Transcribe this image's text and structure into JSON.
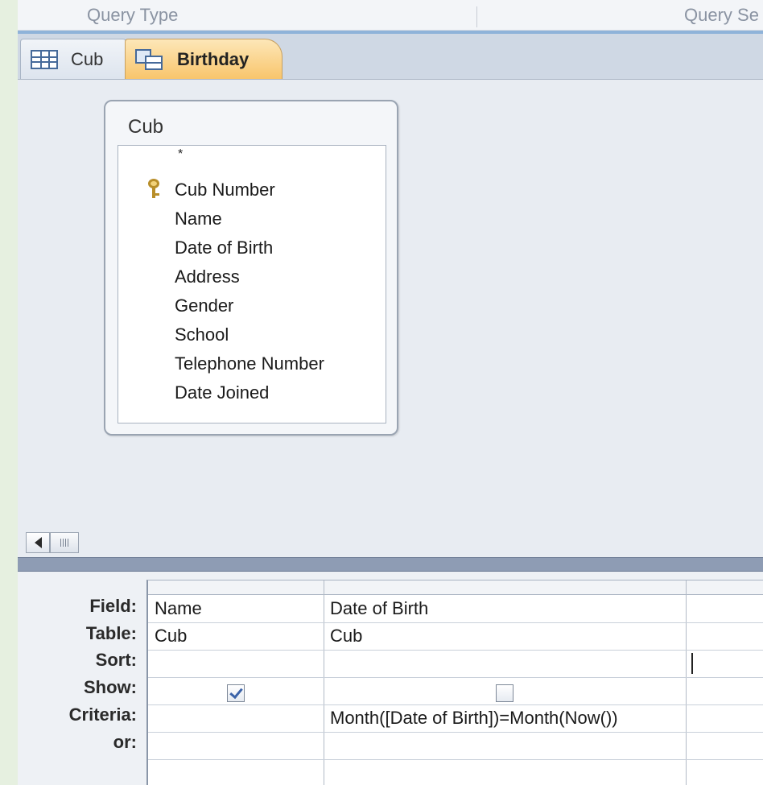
{
  "ribbon": {
    "group_left": "Query Type",
    "group_right": "Query Se"
  },
  "tabs": [
    {
      "label": "Cub",
      "icon": "table-icon",
      "active": false
    },
    {
      "label": "Birthday",
      "icon": "query-icon",
      "active": true
    }
  ],
  "field_list": {
    "title": "Cub",
    "fields": [
      {
        "name": "*",
        "primary_key": false
      },
      {
        "name": "Cub Number",
        "primary_key": true
      },
      {
        "name": "Name",
        "primary_key": false
      },
      {
        "name": "Date of Birth",
        "primary_key": false
      },
      {
        "name": "Address",
        "primary_key": false
      },
      {
        "name": "Gender",
        "primary_key": false
      },
      {
        "name": "School",
        "primary_key": false
      },
      {
        "name": "Telephone Number",
        "primary_key": false
      },
      {
        "name": "Date Joined",
        "primary_key": false
      }
    ]
  },
  "grid": {
    "row_labels": [
      "Field:",
      "Table:",
      "Sort:",
      "Show:",
      "Criteria:",
      "or:"
    ],
    "columns": [
      {
        "field": "Name",
        "table": "Cub",
        "sort": "",
        "show": true,
        "criteria": "",
        "or": ""
      },
      {
        "field": "Date of Birth",
        "table": "Cub",
        "sort": "",
        "show": false,
        "criteria": "Month([Date of Birth])=Month(Now())",
        "or": ""
      },
      {
        "field": "",
        "table": "",
        "sort": "",
        "show": false,
        "criteria": "",
        "or": ""
      }
    ]
  },
  "colors": {
    "active_tab": "#f8c56c",
    "splitter": "#8e9cb4",
    "checkmark": "#3b63a8"
  }
}
